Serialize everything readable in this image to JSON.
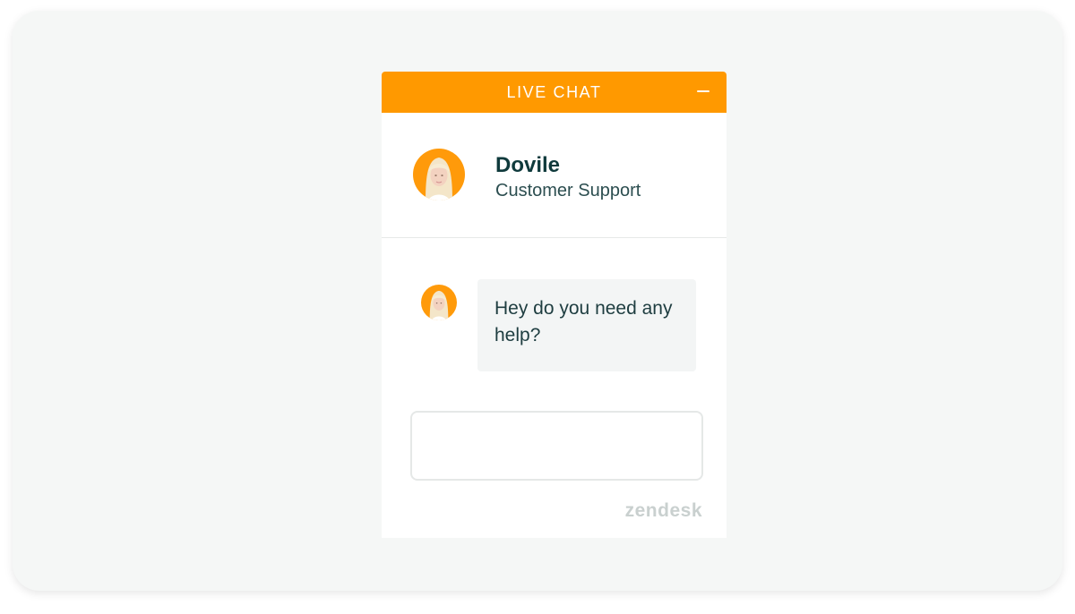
{
  "widget": {
    "header_title": "LIVE CHAT",
    "minimize_icon": "minimize-icon",
    "accent_color": "#ff9900"
  },
  "agent": {
    "name": "Dovile",
    "role": "Customer Support",
    "avatar_icon": "agent-avatar-icon"
  },
  "messages": [
    {
      "from": "agent",
      "text": "Hey do you need any help?"
    }
  ],
  "composer": {
    "value": "",
    "placeholder": ""
  },
  "branding": {
    "label": "zendesk"
  }
}
